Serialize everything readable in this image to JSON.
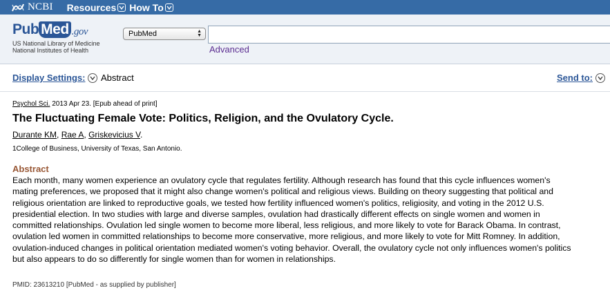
{
  "topbar": {
    "logo_text": "NCBI",
    "nav": [
      {
        "label": "Resources"
      },
      {
        "label": "How To"
      }
    ]
  },
  "header": {
    "logo_pub": "Pub",
    "logo_med": "Med",
    "logo_gov": ".gov",
    "logo_sub_line1": "US National Library of Medicine",
    "logo_sub_line2": "National Institutes of Health",
    "database_selected": "PubMed",
    "search_value": "",
    "advanced_label": "Advanced"
  },
  "display_bar": {
    "settings_label": "Display Settings:",
    "settings_value": "Abstract",
    "send_to_label": "Send to:"
  },
  "article": {
    "journal": "Psychol Sci.",
    "citation_rest": " 2013 Apr 23. [Epub ahead of print]",
    "title": "The Fluctuating Female Vote: Politics, Religion, and the Ovulatory Cycle.",
    "authors": [
      "Durante KM",
      "Rae A",
      "Griskevicius V"
    ],
    "author_sep_1": ", ",
    "author_sep_2": ", ",
    "author_end": ".",
    "affiliation": "1College of Business, University of Texas, San Antonio.",
    "abstract_heading": "Abstract",
    "abstract_lines": [
      "Each month, many women experience an ovulatory cycle that regulates fertility. Although research has found that this cycle influences women's",
      "mating preferences, we proposed that it might also change women's political and religious views. Building on theory suggesting that political and",
      "religious orientation are linked to reproductive goals, we tested how fertility influenced women's politics, religiosity, and voting in the 2012 U.S.",
      "presidential election. In two studies with large and diverse samples, ovulation had drastically different effects on single women and women in",
      "committed relationships. Ovulation led single women to become more liberal, less religious, and more likely to vote for Barack Obama. In contrast,",
      "ovulation led women in committed relationships to become more conservative, more religious, and more likely to vote for Mitt Romney. In addition,",
      "ovulation-induced changes in political orientation mediated women's voting behavior. Overall, the ovulatory cycle not only influences women's politics",
      "but also appears to do so differently for single women than for women in relationships."
    ],
    "pmid_line": "PMID: 23613210 [PubMed - as supplied by publisher]"
  },
  "colors": {
    "topbar": "#366ba6",
    "link": "#2b5697",
    "abstract_heading": "#985735",
    "advanced": "#5c2e91"
  },
  "icons": {
    "ncbi": "ncbi-logo-icon",
    "dropdown": "chevron-down-icon"
  }
}
